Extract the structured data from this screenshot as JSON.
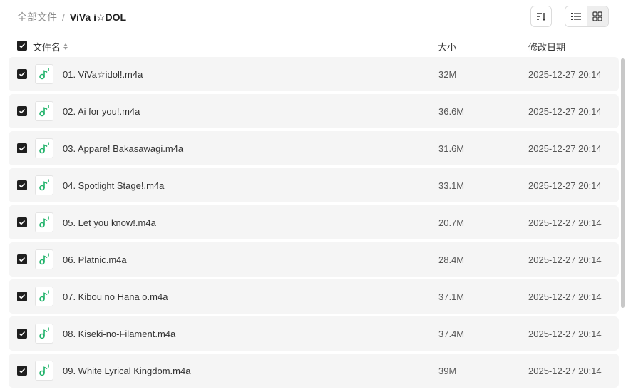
{
  "breadcrumb": {
    "root": "全部文件",
    "separator": "/",
    "current": "ViVa i☆DOL"
  },
  "header": {
    "name": "文件名",
    "size": "大小",
    "date": "修改日期"
  },
  "files": [
    {
      "name": "01. ViVa☆idol!.m4a",
      "size": "32M",
      "date": "2025-12-27 20:14"
    },
    {
      "name": "02. Ai for you!.m4a",
      "size": "36.6M",
      "date": "2025-12-27 20:14"
    },
    {
      "name": "03. Appare! Bakasawagi.m4a",
      "size": "31.6M",
      "date": "2025-12-27 20:14"
    },
    {
      "name": "04. Spotlight Stage!.m4a",
      "size": "33.1M",
      "date": "2025-12-27 20:14"
    },
    {
      "name": "05. Let you know!.m4a",
      "size": "20.7M",
      "date": "2025-12-27 20:14"
    },
    {
      "name": "06. Platnic.m4a",
      "size": "28.4M",
      "date": "2025-12-27 20:14"
    },
    {
      "name": "07. Kibou no Hana o.m4a",
      "size": "37.1M",
      "date": "2025-12-27 20:14"
    },
    {
      "name": "08. Kiseki-no-Filament.m4a",
      "size": "37.4M",
      "date": "2025-12-27 20:14"
    },
    {
      "name": "09. White Lyrical Kingdom.m4a",
      "size": "39M",
      "date": "2025-12-27 20:14"
    }
  ],
  "colors": {
    "accent": "#21b36b",
    "row_bg": "#f5f5f5",
    "checkbox": "#1f1f1f"
  },
  "icons": {
    "sort": "sort-icon",
    "list_view": "list-view-icon",
    "grid_view": "grid-view-icon",
    "file": "audio-file-icon",
    "checkbox": "checkbox-checked-icon"
  },
  "view_mode": "list"
}
